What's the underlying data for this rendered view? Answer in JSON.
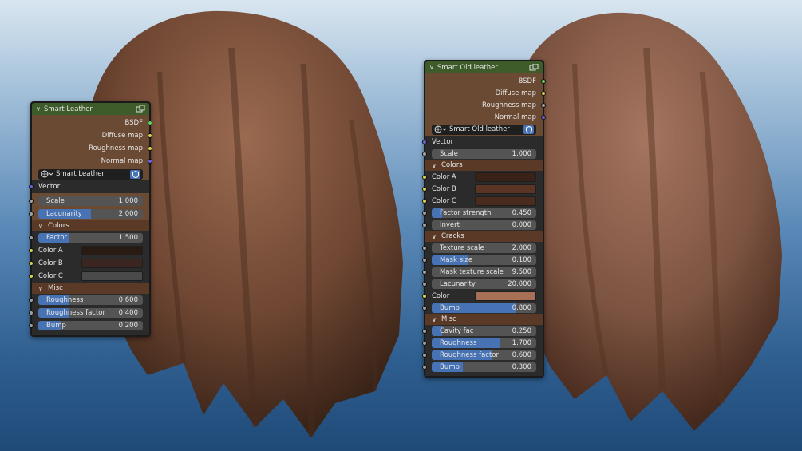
{
  "colors": {
    "node_header": "#3d5c2a",
    "node_body": "#6b4a33",
    "accent": "#4772b3"
  },
  "left_node": {
    "title": "Smart Leather",
    "outputs": [
      "BSDF",
      "Diffuse map",
      "Roughness map",
      "Normal map"
    ],
    "material_name": "Smart Leather",
    "vector_label": "Vector",
    "scale": {
      "label": "Scale",
      "value": "1.000"
    },
    "lacunarity": {
      "label": "Lacunarity",
      "value": "2.000",
      "fill": 0.5
    },
    "colors_section": "Colors",
    "factor": {
      "label": "Factor",
      "value": "1.500",
      "fill": 0.3
    },
    "color_a": {
      "label": "Color A",
      "color": "#2a1a14"
    },
    "color_b": {
      "label": "Color B",
      "color": "#3a2520"
    },
    "color_c": {
      "label": "Color C",
      "color": "#4a4a4a"
    },
    "misc_section": "Misc",
    "roughness": {
      "label": "Roughness",
      "value": "0.600",
      "fill": 0.3
    },
    "roughness_factor": {
      "label": "Roughness factor",
      "value": "0.400",
      "fill": 0.3
    },
    "bump": {
      "label": "Bump",
      "value": "0.200",
      "fill": 0.22
    }
  },
  "right_node": {
    "title": "Smart Old leather",
    "outputs": [
      "BSDF",
      "Diffuse map",
      "Roughness map",
      "Normal map"
    ],
    "material_name": "Smart Old leather",
    "vector_label": "Vector",
    "scale": {
      "label": "Scale",
      "value": "1.000"
    },
    "colors_section": "Colors",
    "color_a": {
      "label": "Color A",
      "color": "#3a2218"
    },
    "color_b": {
      "label": "Color B",
      "color": "#5a3424"
    },
    "color_c": {
      "label": "Color C",
      "color": "#4a2c1e"
    },
    "factor_strength": {
      "label": "Factor strength",
      "value": "0.450",
      "fill": 0.1
    },
    "invert": {
      "label": "Invert",
      "value": "0.000"
    },
    "cracks_section": "Cracks",
    "texture_scale": {
      "label": "Texture scale",
      "value": "2.000"
    },
    "mask_size": {
      "label": "Mask size",
      "value": "0.100",
      "fill": 0.35
    },
    "mask_texture_scale": {
      "label": "Mask texture scale",
      "value": "9.500"
    },
    "lacunarity": {
      "label": "Lacunarity",
      "value": "20.000"
    },
    "crack_color": {
      "label": "Color",
      "color": "#a87054"
    },
    "bump_cracks": {
      "label": "Bump",
      "value": "0.800",
      "fill": 0.8
    },
    "misc_section": "Misc",
    "cavity_fac": {
      "label": "Cavity fac",
      "value": "0.250",
      "fill": 0.1
    },
    "roughness": {
      "label": "Roughness",
      "value": "1.700",
      "fill": 0.66
    },
    "roughness_factor": {
      "label": "Roughness factor",
      "value": "0.600",
      "fill": 0.58
    },
    "bump_misc": {
      "label": "Bump",
      "value": "0.300",
      "fill": 0.3
    }
  }
}
